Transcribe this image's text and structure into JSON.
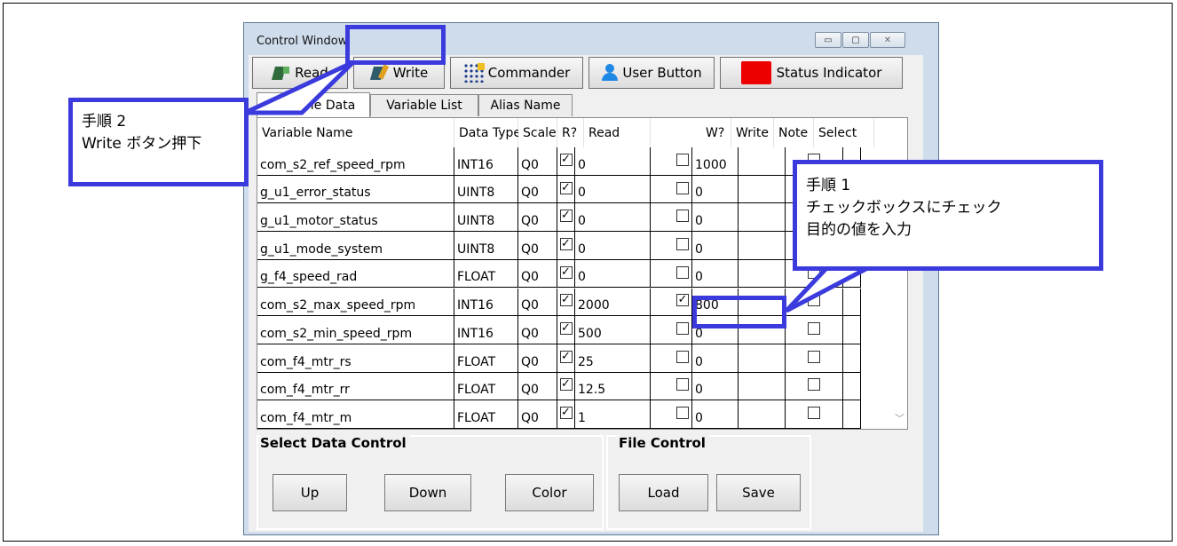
{
  "window": {
    "title": "Control Window",
    "controls": {
      "minimize": "▭",
      "maximize": "▢",
      "close": "✕"
    }
  },
  "toolbar": {
    "read_label": "Read",
    "write_label": "Write",
    "commander_label": "Commander",
    "user_button_label": "User Button",
    "status_indicator_label": "Status Indicator",
    "status_indicator_color": "#ee0000"
  },
  "tabs": [
    "Variable Data",
    "Variable List",
    "Alias Name"
  ],
  "grid": {
    "columns": [
      "Variable Name",
      "Data Type",
      "Scale",
      "R?",
      "Read",
      "W?",
      "Write",
      "Note",
      "Select"
    ],
    "rows": [
      {
        "name": "com_s2_ref_speed_rpm",
        "type": "INT16",
        "scale": "Q0",
        "r": true,
        "read": "0",
        "w": false,
        "write": "1000",
        "note": "",
        "select": false
      },
      {
        "name": "g_u1_error_status",
        "type": "UINT8",
        "scale": "Q0",
        "r": true,
        "read": "0",
        "w": false,
        "write": "0",
        "note": "",
        "select": false
      },
      {
        "name": "g_u1_motor_status",
        "type": "UINT8",
        "scale": "Q0",
        "r": true,
        "read": "0",
        "w": false,
        "write": "0",
        "note": "",
        "select": false
      },
      {
        "name": "g_u1_mode_system",
        "type": "UINT8",
        "scale": "Q0",
        "r": true,
        "read": "0",
        "w": false,
        "write": "0",
        "note": "",
        "select": false
      },
      {
        "name": "g_f4_speed_rad",
        "type": "FLOAT",
        "scale": "Q0",
        "r": true,
        "read": "0",
        "w": false,
        "write": "0",
        "note": "",
        "select": false
      },
      {
        "name": "com_s2_max_speed_rpm",
        "type": "INT16",
        "scale": "Q0",
        "r": true,
        "read": "2000",
        "w": true,
        "write": "800",
        "note": "",
        "select": false
      },
      {
        "name": "com_s2_min_speed_rpm",
        "type": "INT16",
        "scale": "Q0",
        "r": true,
        "read": "500",
        "w": false,
        "write": "0",
        "note": "",
        "select": false
      },
      {
        "name": "com_f4_mtr_rs",
        "type": "FLOAT",
        "scale": "Q0",
        "r": true,
        "read": "25",
        "w": false,
        "write": "0",
        "note": "",
        "select": false
      },
      {
        "name": "com_f4_mtr_rr",
        "type": "FLOAT",
        "scale": "Q0",
        "r": true,
        "read": "12.5",
        "w": false,
        "write": "0",
        "note": "",
        "select": false
      },
      {
        "name": "com_f4_mtr_m",
        "type": "FLOAT",
        "scale": "Q0",
        "r": true,
        "read": "1",
        "w": false,
        "write": "0",
        "note": "",
        "select": false
      }
    ]
  },
  "select_data_control": {
    "title": "Select Data Control",
    "up": "Up",
    "down": "Down",
    "color": "Color"
  },
  "file_control": {
    "title": "File Control",
    "load": "Load",
    "save": "Save"
  },
  "annotations": {
    "step2": {
      "line1": "手順 2",
      "line2": "Write ボタン押下"
    },
    "step1": {
      "line1": "手順 1",
      "line2": "チェックボックスにチェック",
      "line3": "目的の値を入力"
    },
    "highlight_color": "#3b3bdd"
  }
}
